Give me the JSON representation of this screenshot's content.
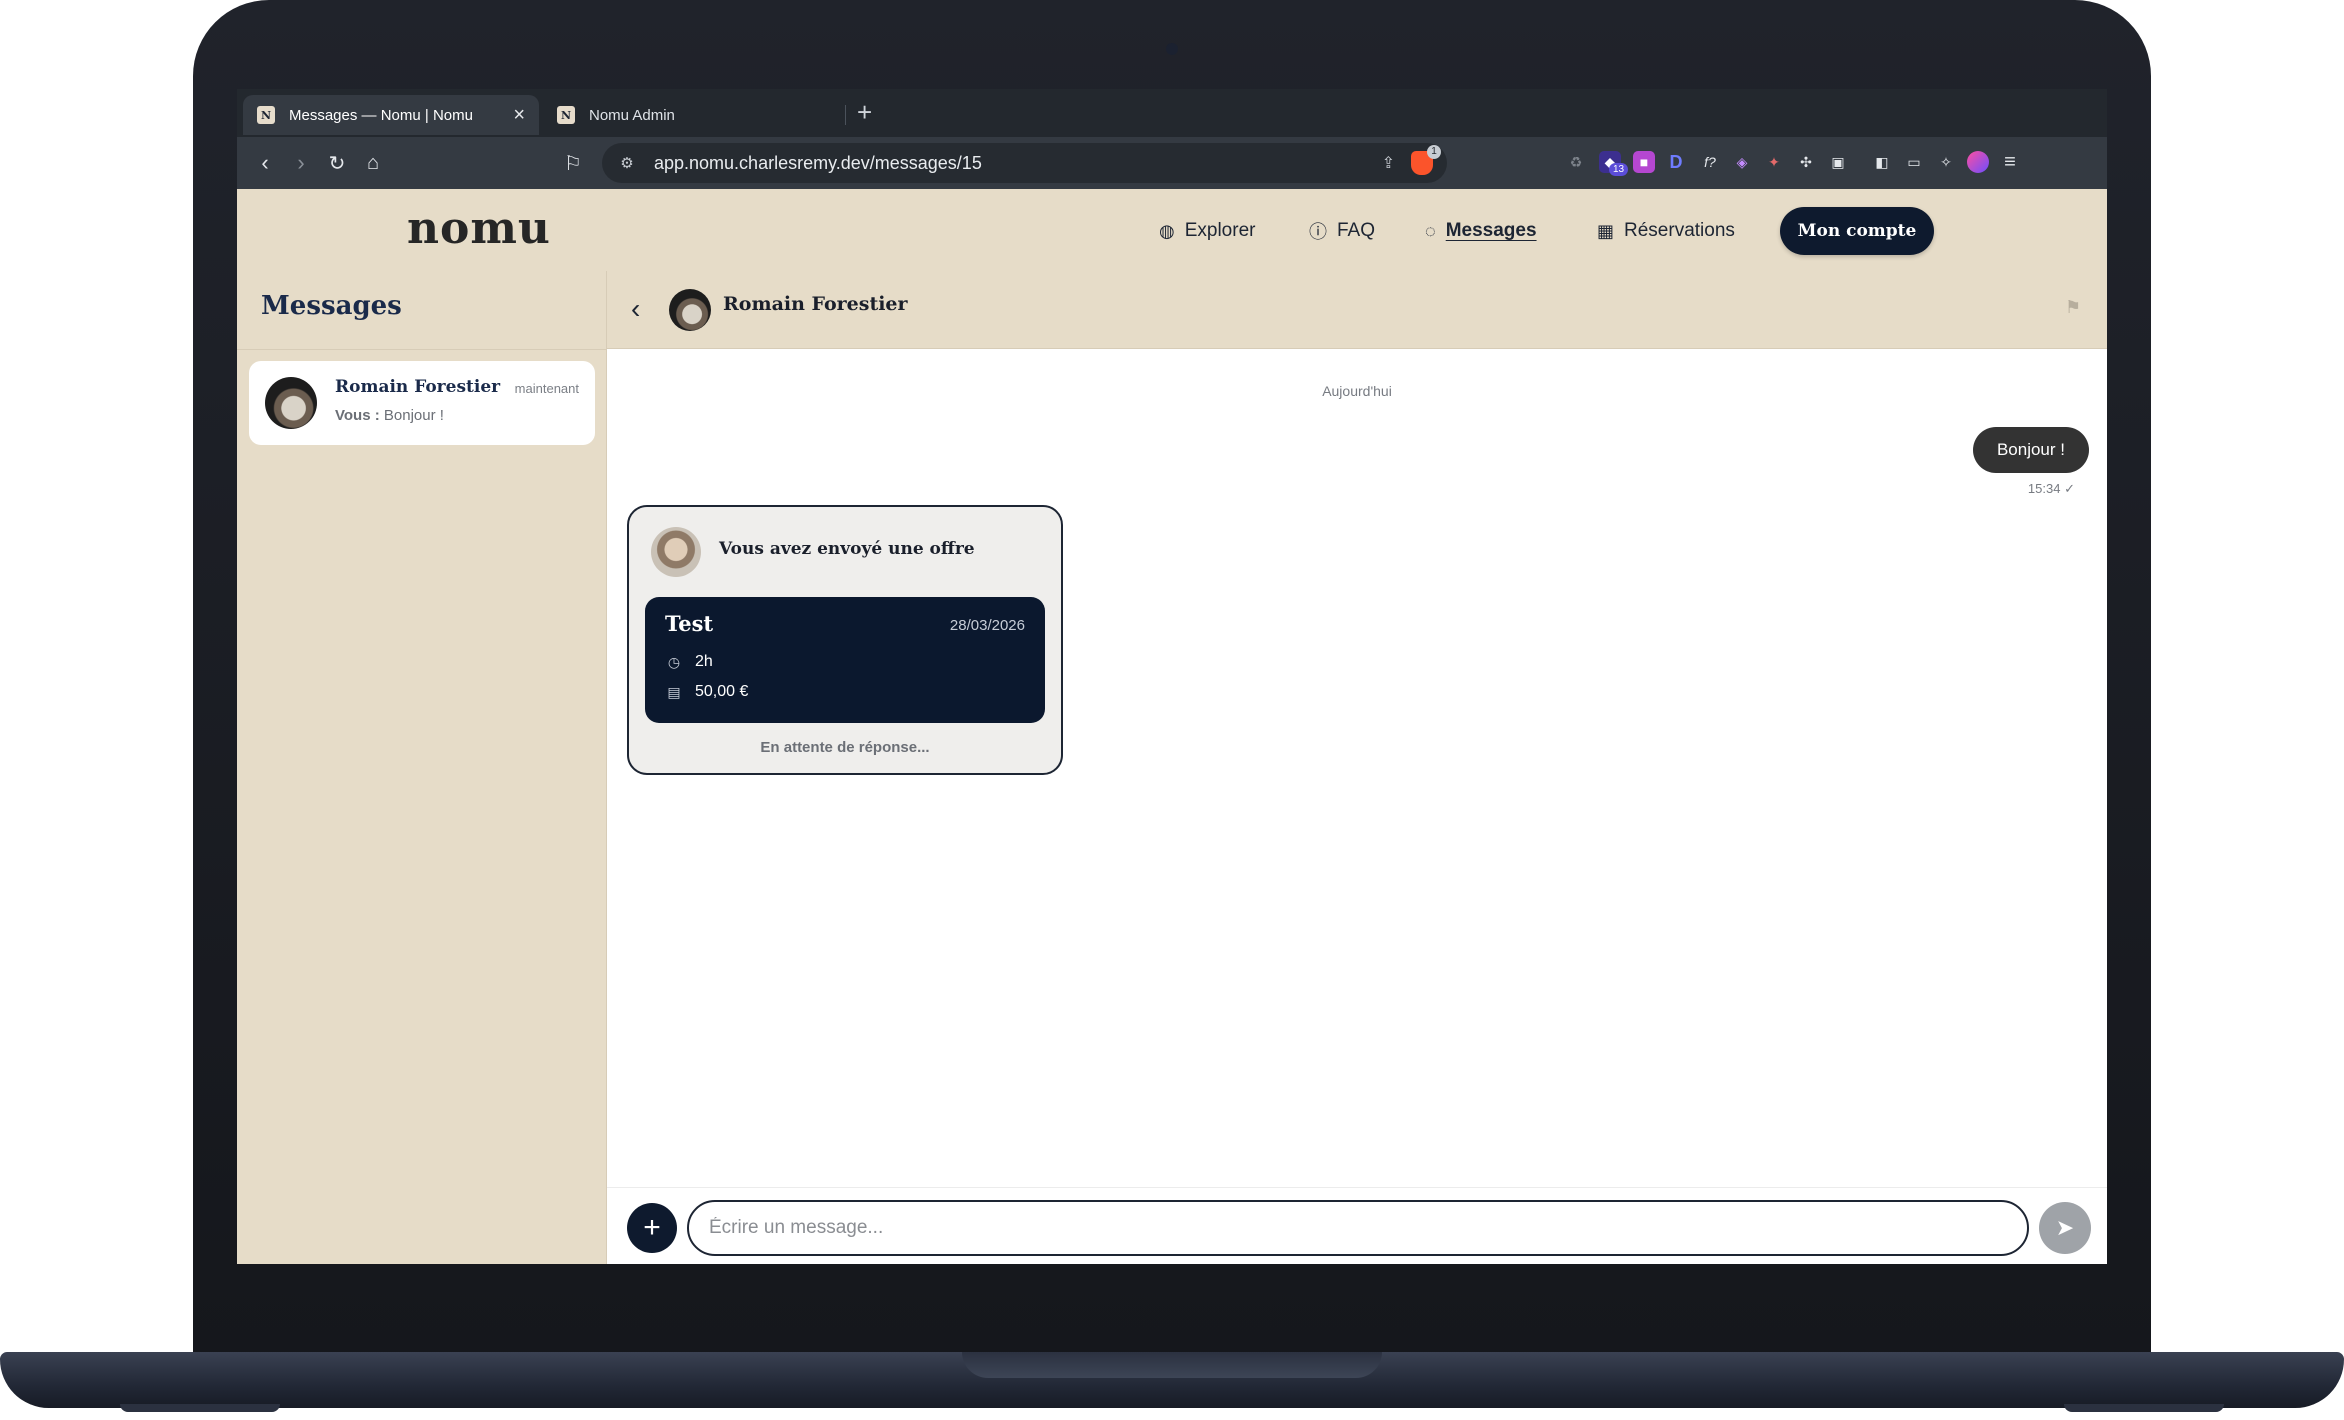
{
  "browser": {
    "tabs": [
      {
        "title": "Messages — Nomu | Nomu",
        "active": true
      },
      {
        "title": "Nomu Admin",
        "active": false
      }
    ],
    "url": "app.nomu.charlesremy.dev/messages/15",
    "brave_badge": "1",
    "extension_badge": "13"
  },
  "header": {
    "logo": "nomu",
    "nav": [
      {
        "label": "Explorer",
        "icon": "globe-icon"
      },
      {
        "label": "FAQ",
        "icon": "help-circle-icon"
      },
      {
        "label": "Messages",
        "icon": "chat-bubble-icon",
        "active": true
      },
      {
        "label": "Réservations",
        "icon": "calendar-icon"
      }
    ],
    "account_button": "Mon compte"
  },
  "sidebar": {
    "title": "Messages",
    "conversations": [
      {
        "name": "Romain Forestier",
        "time": "maintenant",
        "preview_prefix": "Vous :",
        "preview": "Bonjour !"
      }
    ]
  },
  "chat": {
    "contact_name": "Romain Forestier",
    "day_separator": "Aujourd'hui",
    "outgoing_message": {
      "text": "Bonjour !",
      "time": "15:34",
      "status": "✓"
    },
    "offer": {
      "title": "Vous avez envoyé une offre",
      "name": "Test",
      "date": "28/03/2026",
      "duration": "2h",
      "price": "50,00 €",
      "status": "En attente de réponse..."
    },
    "composer_placeholder": "Écrire un message..."
  },
  "colors": {
    "beige": "#e6dcc8",
    "navy": "#0e1a2e",
    "bubble_dark": "#333333"
  }
}
